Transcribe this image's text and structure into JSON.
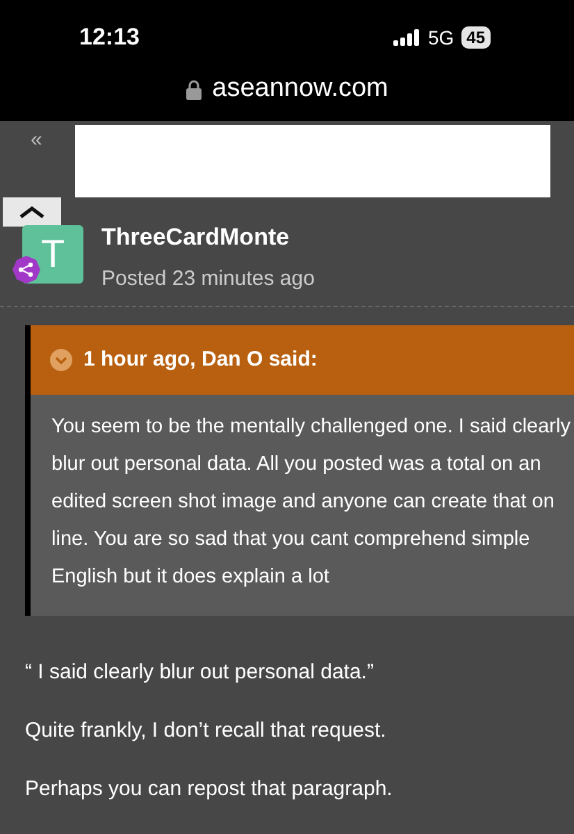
{
  "status_bar": {
    "time": "12:13",
    "network": "5G",
    "battery": "45"
  },
  "address_bar": {
    "url": "aseannow.com"
  },
  "nav": {
    "back": "«"
  },
  "post": {
    "author": "ThreeCardMonte",
    "avatar_letter": "T",
    "meta": "Posted 23 minutes ago",
    "quote": {
      "header": "1 hour ago, Dan O said:",
      "text": "You seem to be the mentally challenged one. I said clearly blur out personal data. All you posted was  a total on an edited screen shot image and anyone can create that on line. You are  so sad that you cant comprehend simple English but it does explain a lot"
    },
    "paragraphs": [
      "“ I said clearly blur out personal data.”",
      "Quite frankly, I don’t recall that request.",
      "Perhaps you can repost that paragraph."
    ]
  }
}
